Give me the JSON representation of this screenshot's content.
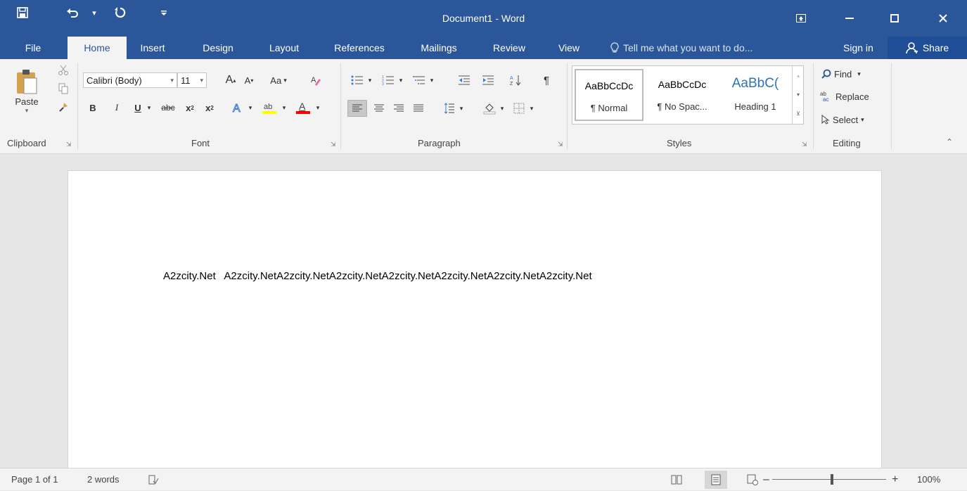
{
  "window": {
    "title": "Document1 - Word"
  },
  "quick_access": {
    "save_icon": "save-icon",
    "undo_icon": "undo-icon",
    "redo_icon": "redo-icon",
    "customize_icon": "customize-icon"
  },
  "tabs": [
    {
      "label": "File"
    },
    {
      "label": "Home"
    },
    {
      "label": "Insert"
    },
    {
      "label": "Design"
    },
    {
      "label": "Layout"
    },
    {
      "label": "References"
    },
    {
      "label": "Mailings"
    },
    {
      "label": "Review"
    },
    {
      "label": "View"
    }
  ],
  "tell_me": {
    "placeholder": "Tell me what you want to do..."
  },
  "account": {
    "sign_in": "Sign in",
    "share": "Share"
  },
  "ribbon": {
    "clipboard": {
      "label": "Clipboard",
      "paste": "Paste"
    },
    "font": {
      "label": "Font",
      "font_name": "Calibri (Body)",
      "font_size": "11",
      "change_case": "Aa"
    },
    "paragraph": {
      "label": "Paragraph"
    },
    "styles": {
      "label": "Styles",
      "items": [
        {
          "preview": "AaBbCcDc",
          "name": "¶ Normal"
        },
        {
          "preview": "AaBbCcDc",
          "name": "¶ No Spac..."
        },
        {
          "preview": "AaBbC(",
          "name": "Heading 1"
        }
      ]
    },
    "editing": {
      "label": "Editing",
      "find": "Find",
      "replace": "Replace",
      "select": "Select"
    }
  },
  "document": {
    "text": "A2zcity.Net   A2zcity.NetA2zcity.NetA2zcity.NetA2zcity.NetA2zcity.NetA2zcity.NetA2zcity.Net"
  },
  "status": {
    "page": "Page 1 of 1",
    "words": "2 words",
    "zoom": "100%",
    "zoom_level": 1.0
  },
  "colors": {
    "brand": "#2b579a",
    "highlight": "#ffff00",
    "font_color": "#ff0000"
  }
}
